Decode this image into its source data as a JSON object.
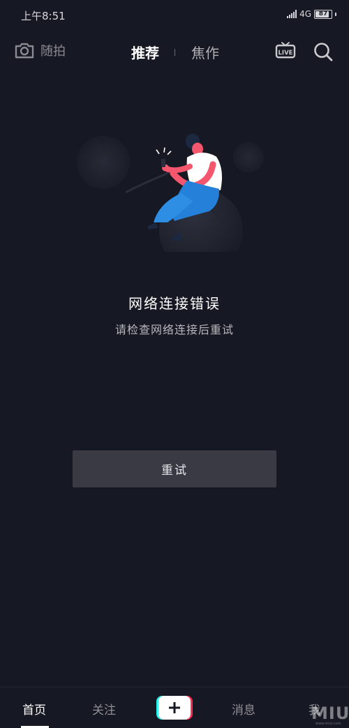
{
  "status_bar": {
    "time": "上午8:51",
    "network": "4G",
    "battery": "87",
    "battery_level": 0.87
  },
  "top_nav": {
    "camera_icon": "camera-icon",
    "camera_label": "随拍",
    "tabs": [
      {
        "label": "推荐",
        "active": true
      },
      {
        "label": "焦作",
        "active": false
      }
    ],
    "live_icon": "live-tv-icon",
    "search_icon": "search-icon"
  },
  "error": {
    "illustration": "person-holding-unplugged-cable",
    "title": "网络连接错误",
    "subtitle": "请检查网络连接后重试",
    "retry_label": "重试"
  },
  "bottom_nav": {
    "items": [
      {
        "label": "首页",
        "active": true
      },
      {
        "label": "关注",
        "active": false
      },
      {
        "label": "",
        "icon": "plus-icon",
        "active": false
      },
      {
        "label": "消息",
        "active": false
      },
      {
        "label": "我",
        "active": false
      }
    ]
  },
  "watermark": {
    "text": "MIUI",
    "subtext": "www.miui.com"
  },
  "colors": {
    "background": "#161823",
    "retry_button": "#3a3a44",
    "accent_cyan": "#25f4ee",
    "accent_red": "#fe2c55"
  }
}
